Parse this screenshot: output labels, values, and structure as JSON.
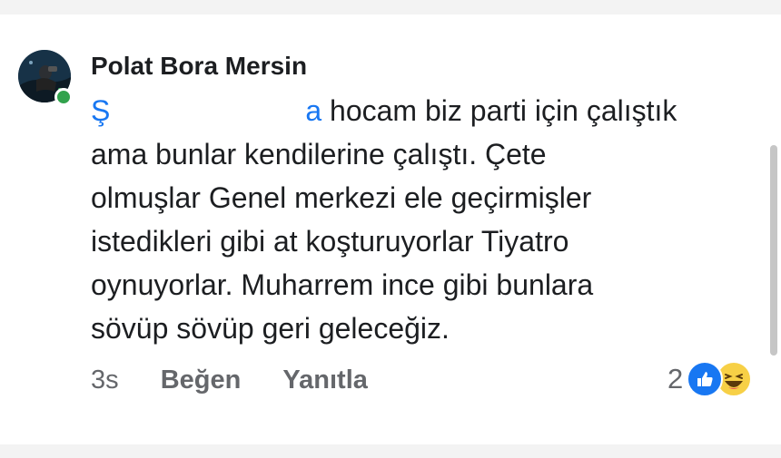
{
  "comment": {
    "author": "Polat Bora Mersin",
    "mention_start": "Ş",
    "mention_end": "a",
    "body_first_line_rest": " hocam biz parti için çalıştık",
    "body_lines": [
      "ama bunlar kendilerine çalıştı. Çete",
      "olmuşlar Genel merkezi ele geçirmişler",
      "istedikleri gibi at koşturuyorlar Tiyatro",
      "oynuyorlar. Muharrem ince gibi bunlara",
      "sövüp sövüp geri geleceğiz."
    ],
    "timestamp": "3s",
    "like_label": "Beğen",
    "reply_label": "Yanıtla",
    "reaction_count": "2",
    "reaction_icons": [
      "like-icon",
      "haha-icon"
    ],
    "online": true
  },
  "colors": {
    "mention": "#1877f2",
    "text": "#1c1e21",
    "meta": "#65676b",
    "presence": "#31a24c",
    "like": "#1877f2",
    "haha": "#f7d046"
  }
}
